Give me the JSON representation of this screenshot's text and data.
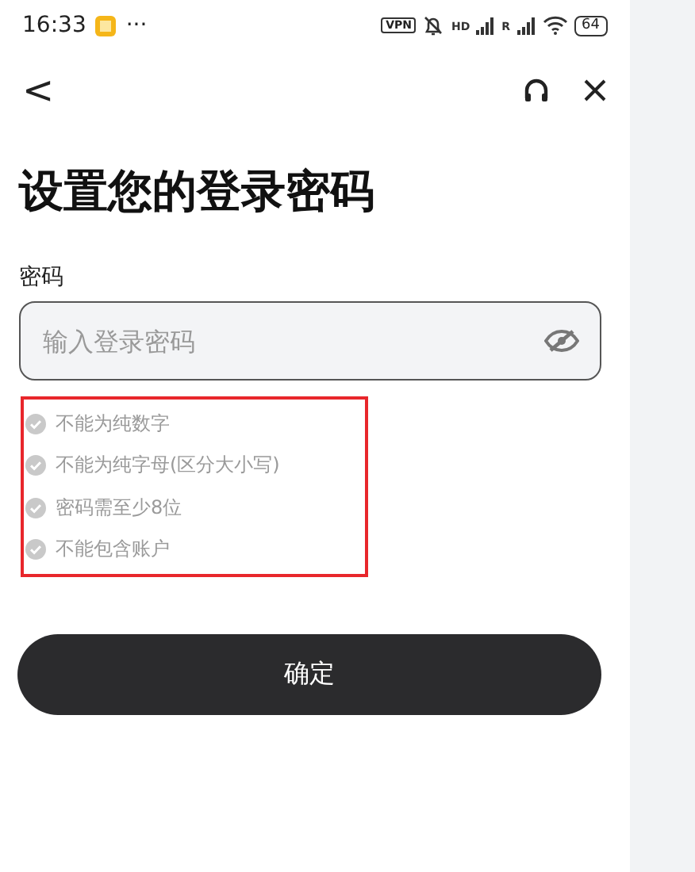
{
  "status_bar": {
    "time": "16:33",
    "more": "···",
    "vpn": "VPN",
    "signal_labels": [
      "HD",
      "R"
    ],
    "battery": "64"
  },
  "nav": {
    "back": "<"
  },
  "title": "设置您的登录密码",
  "password": {
    "label": "密码",
    "placeholder": "输入登录密码",
    "visible": false
  },
  "rules": {
    "highlighted": true,
    "items": [
      {
        "text": "不能为纯数字",
        "met": false
      },
      {
        "text": "不能为纯字母(区分大小写)",
        "met": false
      },
      {
        "text": "密码需至少8位",
        "met": false
      },
      {
        "text": "不能包含账户",
        "met": false
      }
    ]
  },
  "confirm_button": "确定"
}
